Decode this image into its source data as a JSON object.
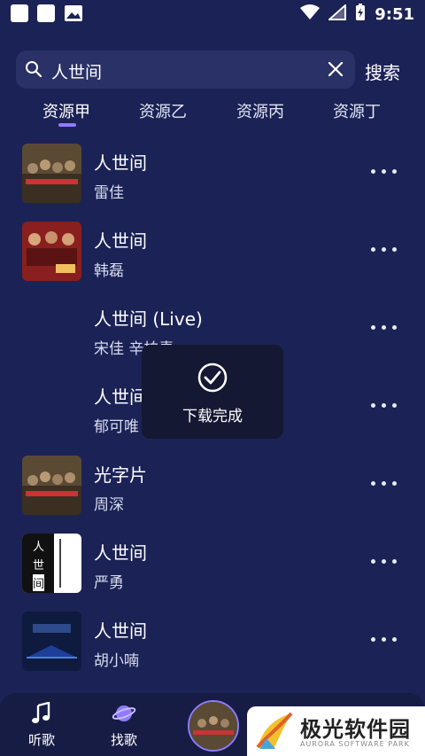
{
  "status_bar": {
    "time": "9:51"
  },
  "search": {
    "query": "人世间",
    "button_label": "搜索"
  },
  "tabs": [
    {
      "label": "资源甲",
      "active": true
    },
    {
      "label": "资源乙",
      "active": false
    },
    {
      "label": "资源丙",
      "active": false
    },
    {
      "label": "资源丁",
      "active": false
    }
  ],
  "results": [
    {
      "title": "人世间",
      "artist": "雷佳",
      "has_cover": true
    },
    {
      "title": "人世间",
      "artist": "韩磊",
      "has_cover": true
    },
    {
      "title": "人世间 (Live)",
      "artist": "宋佳 辛柏青",
      "has_cover": false
    },
    {
      "title": "人世间 (Live)",
      "artist": "郁可唯",
      "has_cover": false
    },
    {
      "title": "光字片",
      "artist": "周深",
      "has_cover": true
    },
    {
      "title": "人世间",
      "artist": "严勇",
      "has_cover": true,
      "cover_text": [
        "人",
        "世",
        "间"
      ]
    },
    {
      "title": "人世间",
      "artist": "胡小喃",
      "has_cover": true
    }
  ],
  "toast": {
    "message": "下载完成"
  },
  "bottom_nav": [
    {
      "label": "听歌",
      "icon": "music-note-icon"
    },
    {
      "label": "找歌",
      "icon": "planet-icon"
    }
  ],
  "watermark": {
    "brand": "极光软件园",
    "sub": "AURORA SOFTWARE PARK"
  },
  "colors": {
    "background": "#1b2255",
    "accent": "#8e7bff",
    "toast_bg": "#151832"
  }
}
